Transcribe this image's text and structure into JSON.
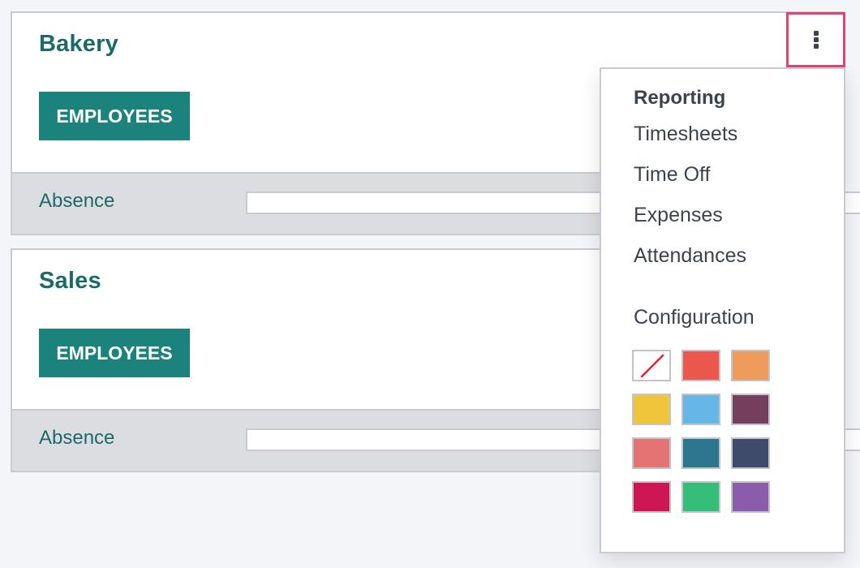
{
  "cards": [
    {
      "title": "Bakery",
      "button_label": "EMPLOYEES",
      "footer_label": "Absence"
    },
    {
      "title": "Sales",
      "button_label": "EMPLOYEES",
      "footer_label": "Absence"
    }
  ],
  "dropdown": {
    "toggle_icon": "vertical-ellipsis-icon",
    "reporting_title": "Reporting",
    "reporting_items": [
      "Timesheets",
      "Time Off",
      "Expenses",
      "Attendances"
    ],
    "configuration_title": "Configuration",
    "colors": [
      {
        "name": "no-color",
        "hex": "#ffffff"
      },
      {
        "name": "red",
        "hex": "#ea574c"
      },
      {
        "name": "orange",
        "hex": "#ee9b5b"
      },
      {
        "name": "yellow",
        "hex": "#f1c53a"
      },
      {
        "name": "light-blue",
        "hex": "#66b7e7"
      },
      {
        "name": "dark-purple",
        "hex": "#733f5d"
      },
      {
        "name": "salmon-pink",
        "hex": "#e57373"
      },
      {
        "name": "medium-blue",
        "hex": "#2c7690"
      },
      {
        "name": "dark-blue",
        "hex": "#3e4b6b"
      },
      {
        "name": "fuchsia",
        "hex": "#cd1653"
      },
      {
        "name": "green",
        "hex": "#35bd79"
      },
      {
        "name": "purple",
        "hex": "#8b5cab"
      }
    ]
  },
  "theme": {
    "primary": "#1c827c",
    "title_color": "#1c6a67",
    "highlight_border": "#e1436b"
  }
}
